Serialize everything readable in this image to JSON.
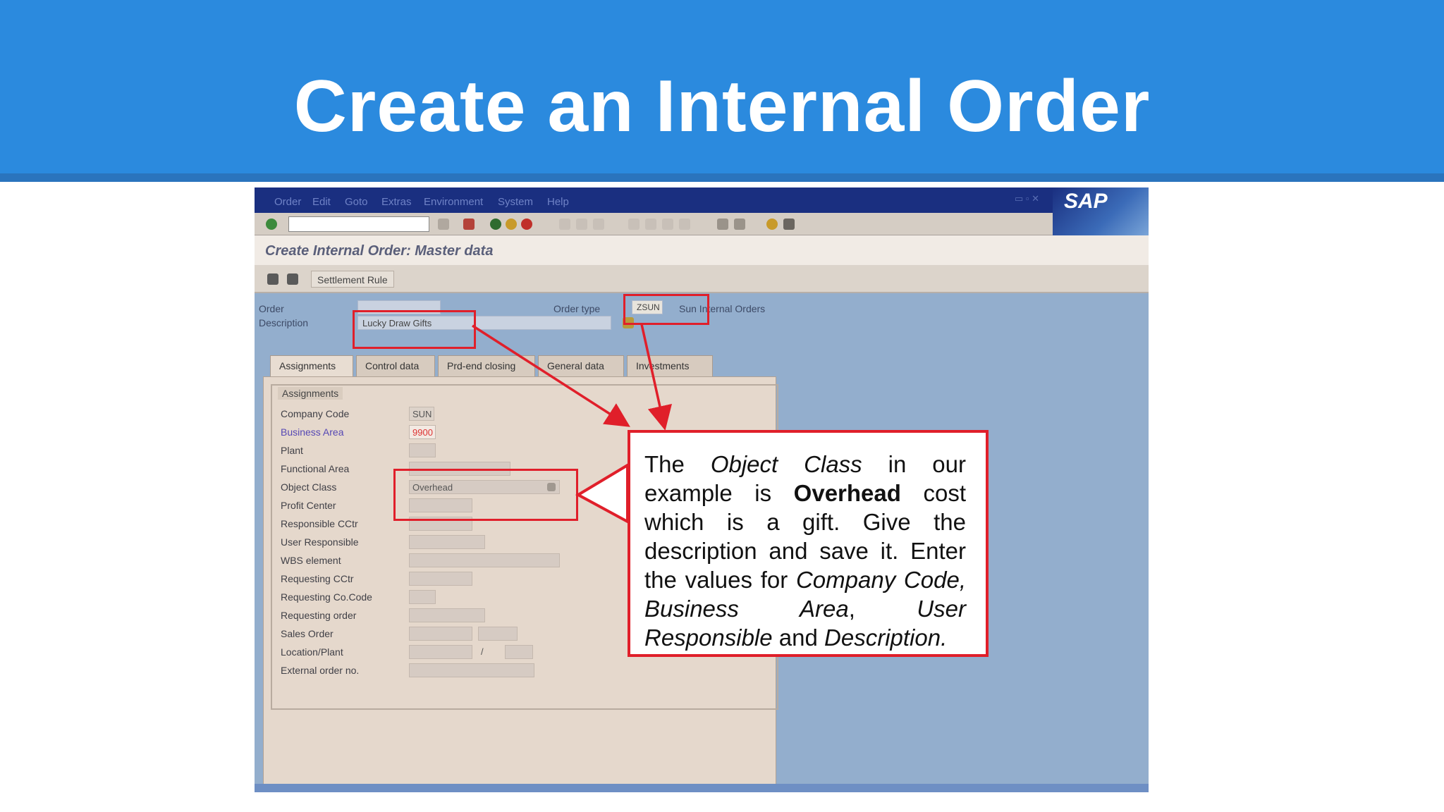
{
  "slide": {
    "title": "Create an Internal Order"
  },
  "sap": {
    "menu": [
      "Order",
      "Edit",
      "Goto",
      "Extras",
      "Environment",
      "System",
      "Help"
    ],
    "logo": "SAP",
    "screen_title": "Create Internal Order: Master data",
    "app_toolbar": {
      "settlement_rule_label": "Settlement Rule"
    },
    "header": {
      "order_label": "Order",
      "order_value": "",
      "description_label": "Description",
      "description_value": "Lucky Draw Gifts",
      "order_type_label": "Order type",
      "order_type_value": "ZSUN",
      "order_type_text": "Sun Internal Orders"
    },
    "tabs": [
      "Assignments",
      "Control data",
      "Prd-end closing",
      "General data",
      "Investments"
    ],
    "assignments": {
      "group_title": "Assignments",
      "rows": [
        {
          "label": "Company Code",
          "value": "SUN"
        },
        {
          "label": "Business Area",
          "value": "9900"
        },
        {
          "label": "Plant",
          "value": ""
        },
        {
          "label": "Functional Area",
          "value": ""
        },
        {
          "label": "Object Class",
          "value": "Overhead"
        },
        {
          "label": "Profit Center",
          "value": ""
        },
        {
          "label": "Responsible CCtr",
          "value": ""
        },
        {
          "label": "User Responsible",
          "value": ""
        },
        {
          "label": "WBS element",
          "value": ""
        },
        {
          "label": "Requesting CCtr",
          "value": ""
        },
        {
          "label": "Requesting Co.Code",
          "value": ""
        },
        {
          "label": "Requesting order",
          "value": ""
        },
        {
          "label": "Sales Order",
          "value": ""
        },
        {
          "label": "Location/Plant",
          "value": "/"
        },
        {
          "label": "External order no.",
          "value": ""
        }
      ]
    }
  },
  "callout": {
    "t1": "The ",
    "t2": "Object Class",
    "t3": " in our example is ",
    "t4": "Overhead",
    "t5": " cost which is a gift. Give the description and save it. Enter the values for ",
    "t6": "Company Code, Business Area",
    "t7": ", ",
    "t8": "User Responsible",
    "t9": " and ",
    "t10": "Description."
  },
  "colors": {
    "banner": "#2b8ade",
    "highlight": "#e01f2a",
    "sap_background": "#93aecd"
  }
}
